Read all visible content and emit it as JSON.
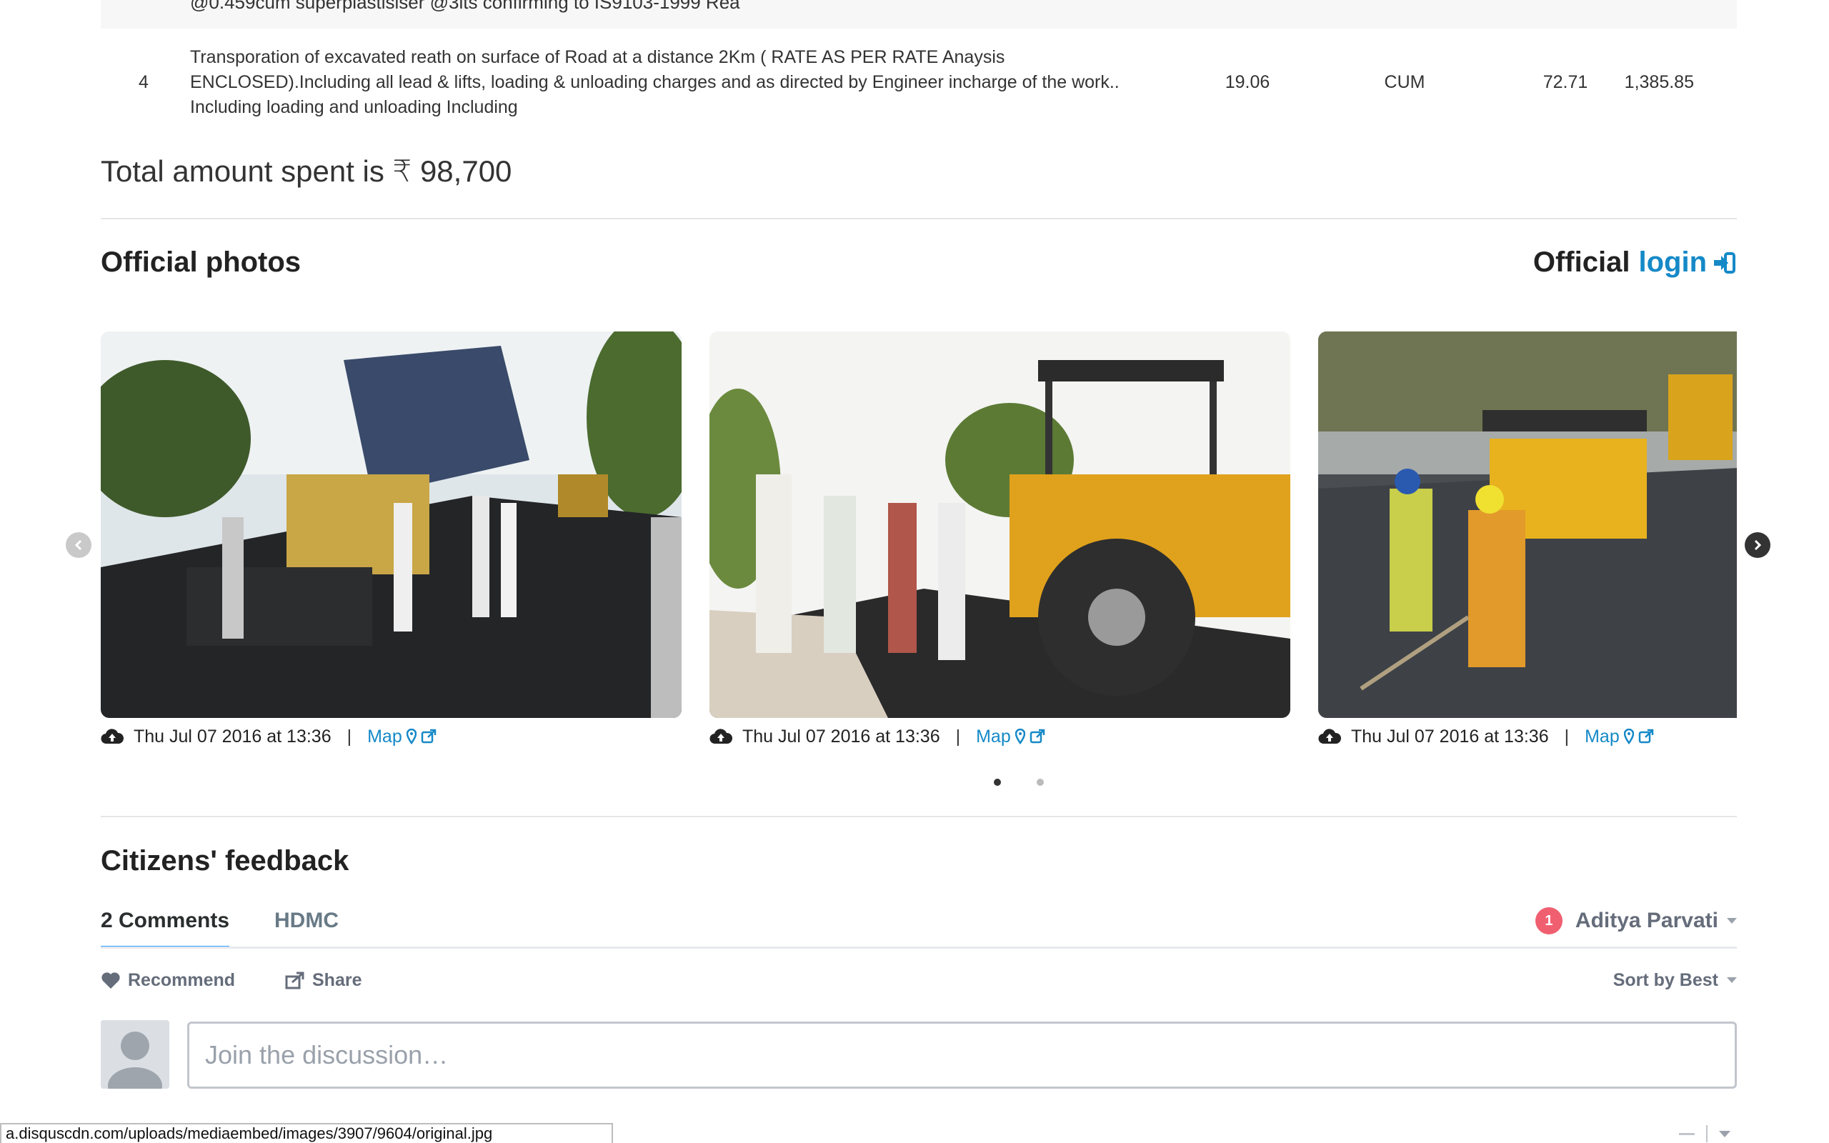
{
  "table": {
    "prev_row_text": "@0.459cum superplastisiser @3lts confirming to IS9103-1999 Rea",
    "row": {
      "sno": "4",
      "description": "Transporation of excavated reath on surface of Road at a distance 2Km ( RATE AS PER RATE Anaysis ENCLOSED).Including all lead & lifts, loading & unloading charges and as directed by Engineer incharge of the work.. Including loading and unloading Including",
      "quantity": "19.06",
      "unit": "CUM",
      "rate": "72.71",
      "amount": "1,385.85"
    }
  },
  "total_text": "Total amount spent is ₹ 98,700",
  "official_photos": {
    "title": "Official photos",
    "login_prefix": "Official",
    "login_link": "login",
    "slides": [
      {
        "date": "Thu Jul 07 2016 at 13:36",
        "separator": "|",
        "map_label": "Map"
      },
      {
        "date": "Thu Jul 07 2016 at 13:36",
        "separator": "|",
        "map_label": "Map"
      },
      {
        "date": "Thu Jul 07 2016 at 13:36",
        "separator": "|",
        "map_label": "Map"
      }
    ],
    "page_count": 2,
    "active_page": 1
  },
  "feedback": {
    "title": "Citizens' feedback",
    "tabs": [
      "2 Comments",
      "HDMC"
    ],
    "notification_count": "1",
    "user_name": "Aditya Parvati",
    "recommend_label": "Recommend",
    "share_label": "Share",
    "sort_label": "Sort by Best",
    "input_placeholder": "Join the discussion…"
  },
  "status_bar_url": "a.disquscdn.com/uploads/mediaembed/images/3907/9604/original.jpg",
  "colors": {
    "link_blue": "#1589c7",
    "disqus_tab_blue": "#2e9fff",
    "badge_red": "#f05f70"
  }
}
